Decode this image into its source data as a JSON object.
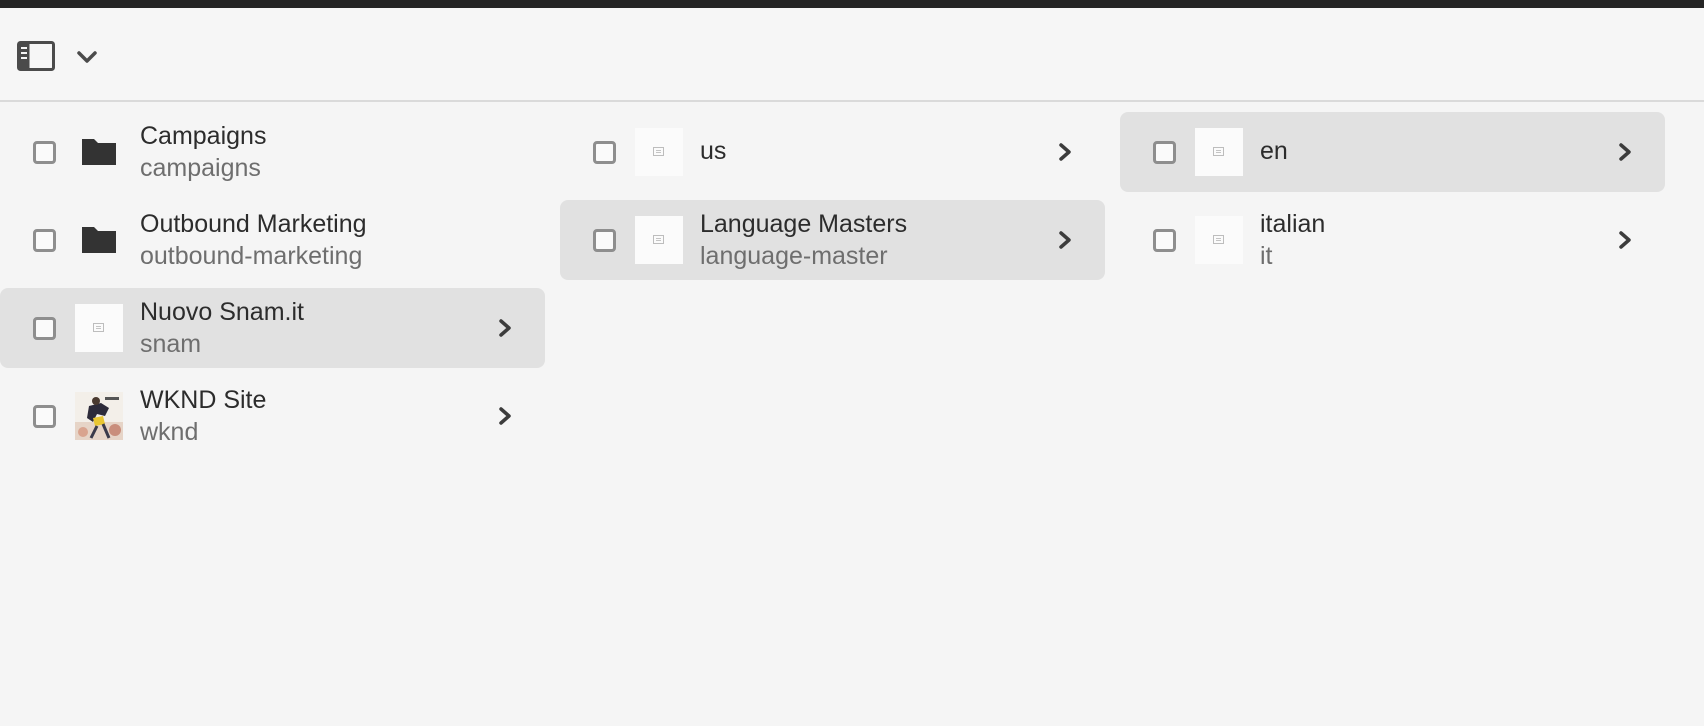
{
  "toolbar": {
    "rail_toggle_icon": "rail-toggle-icon",
    "view_menu_icon": "chevron-down-icon"
  },
  "columns": [
    {
      "items": [
        {
          "title": "Campaigns",
          "name": "campaigns",
          "thumb": "folder-icon",
          "has_children": false,
          "selected": false
        },
        {
          "title": "Outbound Marketing",
          "name": "outbound-marketing",
          "thumb": "folder-icon",
          "has_children": false,
          "selected": false
        },
        {
          "title": "Nuovo Snam.it",
          "name": "snam",
          "thumb": "page-thumbnail",
          "has_children": true,
          "selected": true
        },
        {
          "title": "WKND Site",
          "name": "wknd",
          "thumb": "site-photo-thumbnail",
          "has_children": true,
          "selected": false
        }
      ]
    },
    {
      "items": [
        {
          "title": "us",
          "name": "",
          "thumb": "page-thumbnail",
          "has_children": true,
          "selected": false
        },
        {
          "title": "Language Masters",
          "name": "language-master",
          "thumb": "page-thumbnail",
          "has_children": true,
          "selected": true
        }
      ]
    },
    {
      "items": [
        {
          "title": "en",
          "name": "",
          "thumb": "page-thumbnail",
          "has_children": true,
          "selected": true
        },
        {
          "title": "italian",
          "name": "it",
          "thumb": "page-thumbnail",
          "has_children": true,
          "selected": false
        }
      ]
    }
  ],
  "colors": {
    "background": "#f5f5f5",
    "selected_row": "#e1e1e1",
    "top_bar": "#252525",
    "text_primary": "#2c2c2c",
    "text_secondary": "#6e6e6e"
  }
}
